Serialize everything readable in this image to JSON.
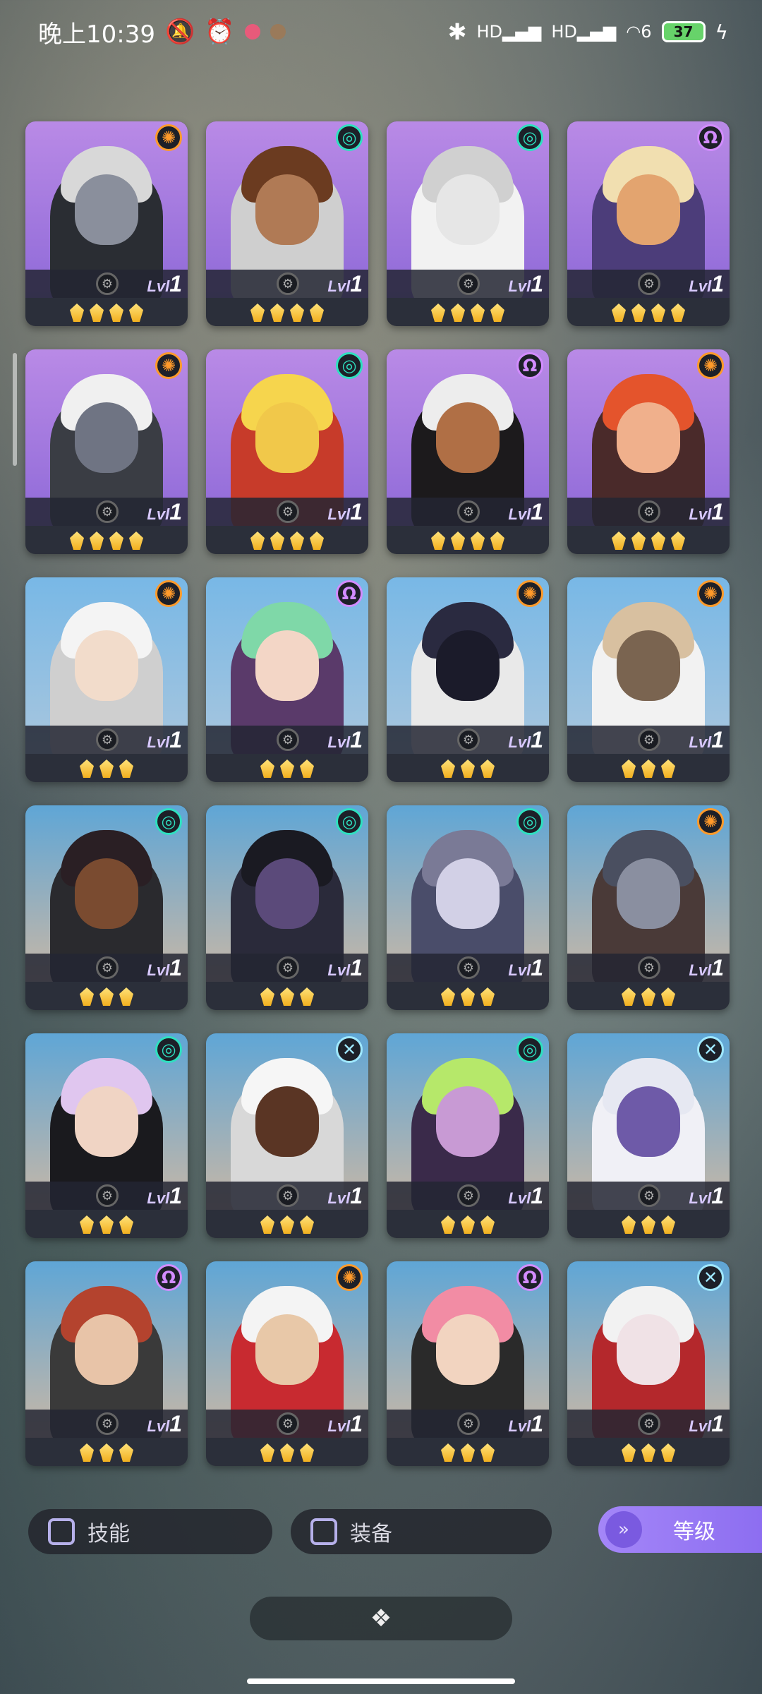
{
  "status_bar": {
    "time": "晚上10:39",
    "battery": "37",
    "signal_1": "HD",
    "signal_2": "HD",
    "wifi_label": "6"
  },
  "cards": [
    {
      "element": "sun",
      "bg": "purple",
      "skin": "#8a8f9c",
      "hair": "#d8d8d8",
      "outfit": "#2a2d33",
      "stars": 4,
      "lvl_label": "Lvl",
      "level": "1"
    },
    {
      "element": "swirl",
      "bg": "purple",
      "skin": "#b07a55",
      "hair": "#6b3b20",
      "outfit": "#cfcfcf",
      "stars": 4,
      "lvl_label": "Lvl",
      "level": "1"
    },
    {
      "element": "swirl",
      "bg": "purple",
      "skin": "#e6e6e6",
      "hair": "#d0d0d0",
      "outfit": "#f2f2f2",
      "stars": 4,
      "lvl_label": "Lvl",
      "level": "1"
    },
    {
      "element": "omega",
      "bg": "purple",
      "skin": "#e3a46f",
      "hair": "#f1dfb0",
      "outfit": "#4c3d7a",
      "stars": 4,
      "lvl_label": "Lvl",
      "level": "1"
    },
    {
      "element": "sun",
      "bg": "purple",
      "skin": "#6f7483",
      "hair": "#f0f0f0",
      "outfit": "#3a3d44",
      "stars": 4,
      "lvl_label": "Lvl",
      "level": "1"
    },
    {
      "element": "swirl",
      "bg": "purple",
      "skin": "#f1c84a",
      "hair": "#f6d54d",
      "outfit": "#c73b2a",
      "stars": 4,
      "lvl_label": "Lvl",
      "level": "1"
    },
    {
      "element": "omega",
      "bg": "purple",
      "skin": "#b06f45",
      "hair": "#ededed",
      "outfit": "#1c1a1c",
      "stars": 4,
      "lvl_label": "Lvl",
      "level": "1"
    },
    {
      "element": "sun",
      "bg": "purple",
      "skin": "#f0b08c",
      "hair": "#e4542c",
      "outfit": "#4a2a2a",
      "stars": 4,
      "lvl_label": "Lvl",
      "level": "1"
    },
    {
      "element": "sun",
      "bg": "blue",
      "skin": "#f2dccb",
      "hair": "#f4f4f4",
      "outfit": "#cfcfcf",
      "stars": 3,
      "lvl_label": "Lvl",
      "level": "1"
    },
    {
      "element": "omega",
      "bg": "blue",
      "skin": "#f3d6c6",
      "hair": "#7fd8a8",
      "outfit": "#5a3a6a",
      "stars": 3,
      "lvl_label": "Lvl",
      "level": "1"
    },
    {
      "element": "sun",
      "bg": "blue",
      "skin": "#1b1b2a",
      "hair": "#2a2a40",
      "outfit": "#e9e9e9",
      "stars": 3,
      "lvl_label": "Lvl",
      "level": "1"
    },
    {
      "element": "sun",
      "bg": "blue",
      "skin": "#7a6450",
      "hair": "#d8c0a0",
      "outfit": "#f2f2f2",
      "stars": 3,
      "lvl_label": "Lvl",
      "level": "1"
    },
    {
      "element": "swirl",
      "bg": "sky",
      "skin": "#7a4b30",
      "hair": "#2a1f24",
      "outfit": "#2a2a2e",
      "stars": 3,
      "lvl_label": "Lvl",
      "level": "1"
    },
    {
      "element": "swirl",
      "bg": "sky",
      "skin": "#5b4a7a",
      "hair": "#1a1a22",
      "outfit": "#2a2a3a",
      "stars": 3,
      "lvl_label": "Lvl",
      "level": "1"
    },
    {
      "element": "swirl",
      "bg": "sky",
      "skin": "#d2d0e6",
      "hair": "#7a7a96",
      "outfit": "#4a4d6a",
      "stars": 3,
      "lvl_label": "Lvl",
      "level": "1"
    },
    {
      "element": "sun",
      "bg": "sky",
      "skin": "#8a8fa0",
      "hair": "#4a4f60",
      "outfit": "#4a3a38",
      "stars": 3,
      "lvl_label": "Lvl",
      "level": "1"
    },
    {
      "element": "swirl",
      "bg": "sky",
      "skin": "#f0d4c4",
      "hair": "#e0c6ef",
      "outfit": "#1a1a1e",
      "stars": 3,
      "lvl_label": "Lvl",
      "level": "1"
    },
    {
      "element": "cross",
      "bg": "sky",
      "skin": "#5a3524",
      "hair": "#f6f6f6",
      "outfit": "#d8d8d8",
      "stars": 3,
      "lvl_label": "Lvl",
      "level": "1"
    },
    {
      "element": "swirl",
      "bg": "sky",
      "skin": "#c89ad4",
      "hair": "#b6e86a",
      "outfit": "#3a2a4a",
      "stars": 3,
      "lvl_label": "Lvl",
      "level": "1"
    },
    {
      "element": "cross",
      "bg": "sky",
      "skin": "#6e5aa8",
      "hair": "#e6e8f2",
      "outfit": "#f0f0f6",
      "stars": 3,
      "lvl_label": "Lvl",
      "level": "1"
    },
    {
      "element": "omega",
      "bg": "sky",
      "skin": "#e8c4a8",
      "hair": "#b4432e",
      "outfit": "#3a3a3a",
      "stars": 3,
      "lvl_label": "Lvl",
      "level": "1"
    },
    {
      "element": "sun",
      "bg": "sky",
      "skin": "#e8c8a8",
      "hair": "#f4f4f4",
      "outfit": "#c82a30",
      "stars": 3,
      "lvl_label": "Lvl",
      "level": "1"
    },
    {
      "element": "omega",
      "bg": "sky",
      "skin": "#f2d4c0",
      "hair": "#f28ca4",
      "outfit": "#2a2a2a",
      "stars": 3,
      "lvl_label": "Lvl",
      "level": "1"
    },
    {
      "element": "cross",
      "bg": "sky",
      "skin": "#f0e2e6",
      "hair": "#f2f2f2",
      "outfit": "#b4282c",
      "stars": 3,
      "lvl_label": "Lvl",
      "level": "1"
    }
  ],
  "element_styles": {
    "sun": {
      "glyph": "✺",
      "color": "#ff9a2a"
    },
    "swirl": {
      "glyph": "◎",
      "color": "#2fe0c0"
    },
    "omega": {
      "glyph": "Ω",
      "color": "#d28cff"
    },
    "cross": {
      "glyph": "✕",
      "color": "#9fe8ff"
    }
  },
  "filters": {
    "skill_label": "技能",
    "equipment_label": "装备",
    "level_label": "等级"
  },
  "drawer": {
    "icon": "❖"
  }
}
